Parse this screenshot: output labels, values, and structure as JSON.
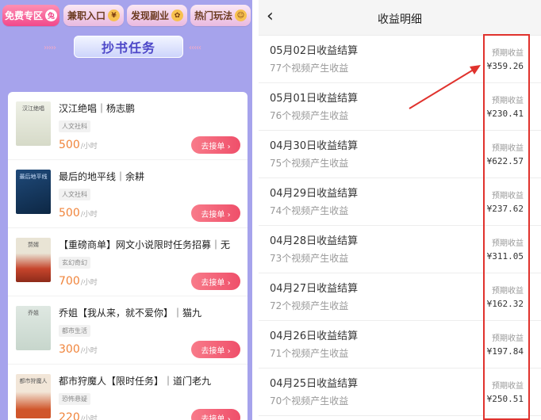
{
  "left": {
    "top_pills": [
      {
        "label": "免费专区",
        "icon": "兔"
      },
      {
        "label": "兼职入口",
        "icon": "¥"
      },
      {
        "label": "发现副业",
        "icon": "✿"
      },
      {
        "label": "热门玩法",
        "icon": "☺"
      }
    ],
    "banner_title": "抄书任务",
    "grab_label": "去接单 ›",
    "unit": "/小时",
    "tasks": [
      {
        "title": "汉江绝唱｜杨志鹏",
        "tag": "人文社科",
        "price": "500",
        "cover": "汉江绝唱"
      },
      {
        "title": "最后的地平线｜余耕",
        "tag": "人文社科",
        "price": "500",
        "cover": "最后地平线"
      },
      {
        "title": "【重磅商单】网文小说限时任务招募｜无",
        "tag": "玄幻奇幻",
        "price": "700",
        "cover": "赘婿"
      },
      {
        "title": "乔姐【我从来，就不爱你】｜猫九",
        "tag": "都市生活",
        "price": "300",
        "cover": "乔姐"
      },
      {
        "title": "都市狩魔人【限时任务】｜道门老九",
        "tag": "恐怖悬疑",
        "price": "220",
        "cover": "都市狩魔人"
      }
    ]
  },
  "right": {
    "back_icon": "chevron-left-icon",
    "title": "收益明细",
    "label": "预期收益",
    "rows": [
      {
        "title": "05月02日收益结算",
        "sub": "77个视频产生收益",
        "amount": "¥359.26"
      },
      {
        "title": "05月01日收益结算",
        "sub": "76个视频产生收益",
        "amount": "¥230.41"
      },
      {
        "title": "04月30日收益结算",
        "sub": "75个视频产生收益",
        "amount": "¥622.57"
      },
      {
        "title": "04月29日收益结算",
        "sub": "74个视频产生收益",
        "amount": "¥237.62"
      },
      {
        "title": "04月28日收益结算",
        "sub": "73个视频产生收益",
        "amount": "¥311.05"
      },
      {
        "title": "04月27日收益结算",
        "sub": "72个视频产生收益",
        "amount": "¥162.32"
      },
      {
        "title": "04月26日收益结算",
        "sub": "71个视频产生收益",
        "amount": "¥197.84"
      },
      {
        "title": "04月25日收益结算",
        "sub": "70个视频产生收益",
        "amount": "¥250.51"
      }
    ]
  },
  "colors": {
    "accent_red": "#e0322d",
    "price_orange": "#f0843b",
    "panel_purple": "#a6a3ec"
  }
}
